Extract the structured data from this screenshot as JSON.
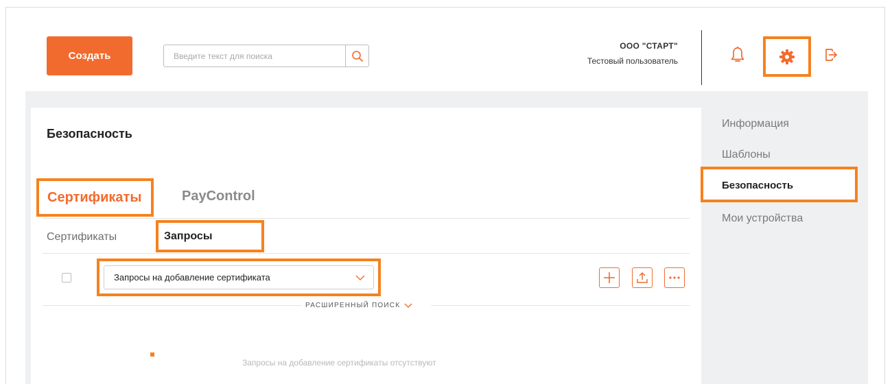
{
  "header": {
    "create_label": "Создать",
    "search_placeholder": "Введите текст для поиска",
    "org_name": "ООО \"СТАРТ\"",
    "user_name": "Тестовый пользователь"
  },
  "page": {
    "title": "Безопасность",
    "tabs": [
      {
        "label": "Сертификаты",
        "active": true
      },
      {
        "label": "PayControl",
        "active": false
      }
    ],
    "subtabs": [
      {
        "label": "Сертификаты",
        "active": false
      },
      {
        "label": "Запросы",
        "active": true
      }
    ],
    "filter_selected": "Запросы на добавление сертификата",
    "advanced_search_label": "РАСШИРЕННЫЙ ПОИСК",
    "empty_message": "Запросы на добавление сертификаты отсутствуют"
  },
  "sidenav": {
    "items": [
      {
        "label": "Информация"
      },
      {
        "label": "Шаблоны"
      },
      {
        "label": "Безопасность",
        "active": true
      },
      {
        "label": "Мои устройства"
      }
    ]
  },
  "colors": {
    "accent": "#f26b2e",
    "highlight": "#f5821f",
    "background": "#eef0f2"
  },
  "icons": [
    "search-icon",
    "bell-icon",
    "gear-icon",
    "logout-icon",
    "plus-icon",
    "upload-icon",
    "more-icon",
    "chevron-down-icon"
  ]
}
